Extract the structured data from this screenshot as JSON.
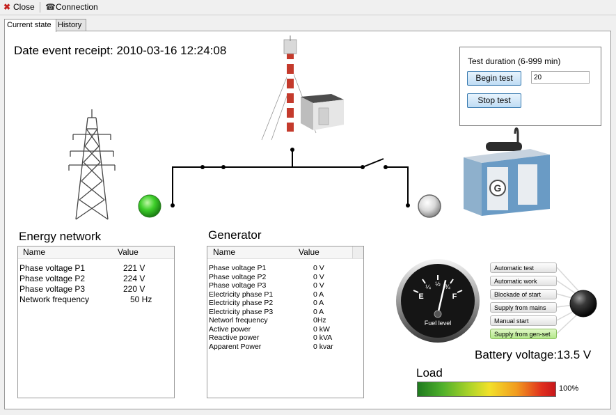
{
  "toolbar": {
    "close_label": "Close",
    "close_icon": "close-icon",
    "connection_label": "Connection",
    "connection_icon": "phone-icon"
  },
  "tabs": [
    {
      "label": "Current state",
      "active": true
    },
    {
      "label": "History",
      "active": false
    }
  ],
  "date_event": {
    "label": "Date event receipt:",
    "value": "2010-03-16 12:24:08"
  },
  "test": {
    "duration_label": "Test duration (6-999 min)",
    "begin_label": "Begin test",
    "stop_label": "Stop test",
    "duration_value": "20"
  },
  "energy_network": {
    "title": "Energy network",
    "col_name": "Name",
    "col_value": "Value",
    "rows": [
      {
        "name": "Phase voltage P1",
        "value": "221 V"
      },
      {
        "name": "Phase voltage P2",
        "value": "224 V"
      },
      {
        "name": "Phase voltage P3",
        "value": "220 V"
      },
      {
        "name": "Network frequency",
        "value": "50 Hz"
      }
    ]
  },
  "generator": {
    "title": "Generator",
    "col_name": "Name",
    "col_value": "Value",
    "rows": [
      {
        "name": "Phase voltage P1",
        "value": "0 V"
      },
      {
        "name": "Phase voltage P2",
        "value": "0 V"
      },
      {
        "name": "Phase voltage P3",
        "value": "0 V"
      },
      {
        "name": "Electricity phase P1",
        "value": "0 A"
      },
      {
        "name": "Electricity phase P2",
        "value": "0 A"
      },
      {
        "name": "Electricity phase P3",
        "value": "0 A"
      },
      {
        "name": "Networl frequency",
        "value": "0Hz"
      },
      {
        "name": "Active power",
        "value": "0 kW"
      },
      {
        "name": "Reactive power",
        "value": "0 kVA"
      },
      {
        "name": "Apparent Power",
        "value": "0 kvar"
      }
    ]
  },
  "mode_selector": {
    "items": [
      {
        "label": "Automatic test",
        "active": false
      },
      {
        "label": "Automatic work",
        "active": false
      },
      {
        "label": "Blockade of start",
        "active": false
      },
      {
        "label": "Supply from mains",
        "active": false
      },
      {
        "label": "Manual start",
        "active": false
      },
      {
        "label": "Supply from gen-set",
        "active": true
      }
    ]
  },
  "fuel_gauge": {
    "label": "Fuel level",
    "marks": [
      "E",
      "¼",
      "½",
      "¾",
      "F"
    ],
    "level": 0.6
  },
  "battery": {
    "label": "Battery voltage:",
    "value": "13.5 V"
  },
  "load": {
    "label": "Load",
    "value_text": "100%",
    "value": 1.0
  },
  "indicators": {
    "network_color": "#3ecf2a",
    "generator_color": "#d9d9d9"
  },
  "icons": {
    "pylon": "power-pylon-icon",
    "telecom": "telecom-tower-icon",
    "genset": "generator-icon",
    "generator_logo": "G"
  }
}
